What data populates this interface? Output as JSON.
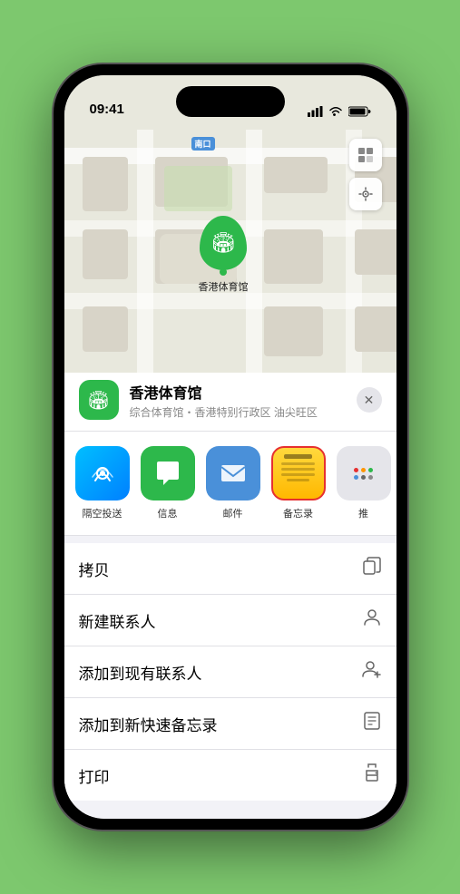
{
  "status_bar": {
    "time": "09:41",
    "signal_bars": "signal-icon",
    "wifi": "wifi-icon",
    "battery": "battery-icon"
  },
  "map": {
    "label_tag": "南口",
    "controls": {
      "map_type": "map-type-icon",
      "location": "location-icon"
    }
  },
  "stadium": {
    "name": "香港体育馆",
    "pin_icon": "🏟"
  },
  "venue_sheet": {
    "title": "香港体育馆",
    "subtitle": "综合体育馆・香港特别行政区 油尖旺区",
    "close_label": "×"
  },
  "share_apps": [
    {
      "id": "airdrop",
      "label": "隔空投送",
      "type": "airdrop"
    },
    {
      "id": "messages",
      "label": "信息",
      "type": "messages"
    },
    {
      "id": "mail",
      "label": "邮件",
      "type": "mail"
    },
    {
      "id": "notes",
      "label": "备忘录",
      "type": "notes",
      "selected": true
    },
    {
      "id": "more",
      "label": "推",
      "type": "more"
    }
  ],
  "action_items": [
    {
      "label": "拷贝",
      "icon": "copy"
    },
    {
      "label": "新建联系人",
      "icon": "person"
    },
    {
      "label": "添加到现有联系人",
      "icon": "person-add"
    },
    {
      "label": "添加到新快速备忘录",
      "icon": "note"
    },
    {
      "label": "打印",
      "icon": "print"
    }
  ],
  "colors": {
    "green": "#2db84b",
    "blue": "#4a90d9",
    "selected_border": "#e63030",
    "background": "#f2f2f7"
  }
}
